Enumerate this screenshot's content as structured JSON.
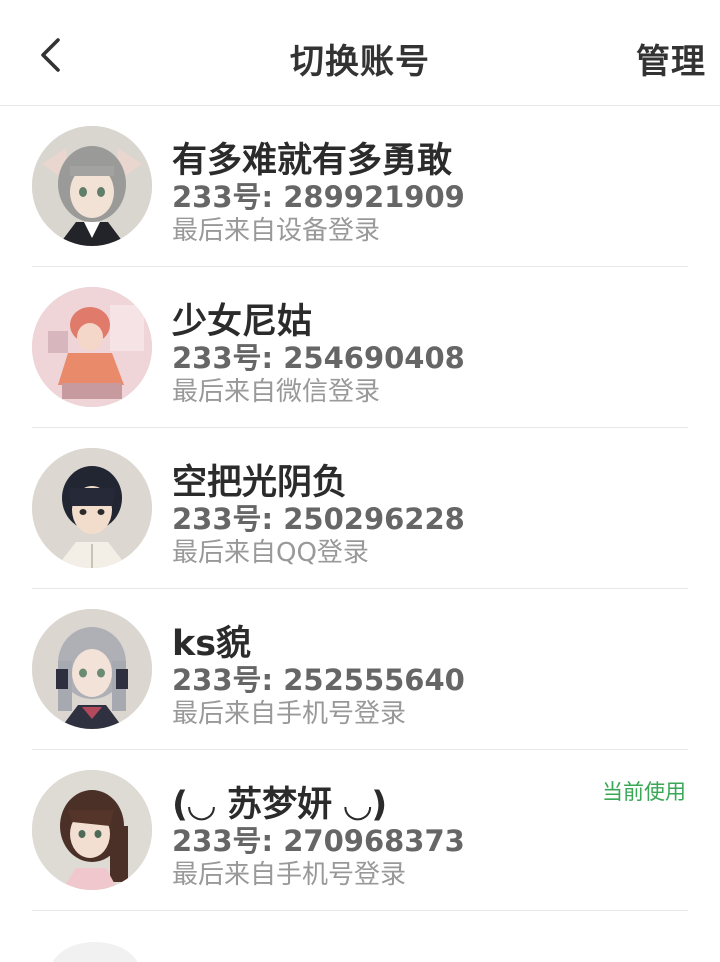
{
  "nav": {
    "title": "切换账号",
    "manage_label": "管理"
  },
  "accounts": [
    {
      "name": "有多难就有多勇敢",
      "id_text": "233号: 289921909",
      "login_text": "最后来自设备登录",
      "current": ""
    },
    {
      "name": "少女尼姑",
      "id_text": "233号: 254690408",
      "login_text": "最后来自微信登录",
      "current": ""
    },
    {
      "name": "空把光阴负",
      "id_text": "233号: 250296228",
      "login_text": "最后来自QQ登录",
      "current": ""
    },
    {
      "name": "ks貌",
      "id_text": "233号: 252555640",
      "login_text": "最后来自手机号登录",
      "current": ""
    },
    {
      "name": "(◡ 苏梦妍 ◡)",
      "id_text": "233号: 270968373",
      "login_text": "最后来自手机号登录",
      "current": "当前使用"
    }
  ],
  "colors": {
    "accent_green": "#3aa757",
    "title_text": "#333333",
    "secondary_text": "#666666",
    "tertiary_text": "#999999",
    "divider": "#e8e8e8"
  }
}
